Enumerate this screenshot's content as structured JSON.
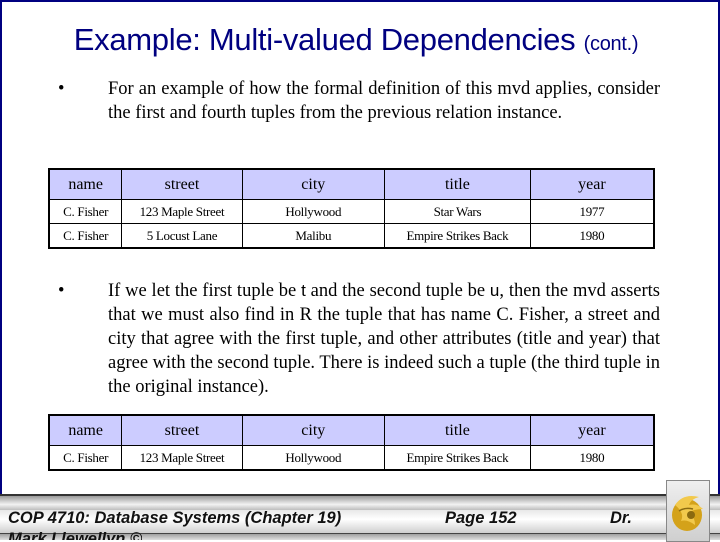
{
  "slide": {
    "title_main": "Example: Multi-valued Dependencies",
    "title_suffix": "(cont.)",
    "bullet_glyph": "•",
    "bullet1": "For an example of how the formal definition of this mvd applies, consider the first and fourth tuples from the previous relation instance.",
    "bullet2": {
      "part1": "If we let the first tuple be ",
      "var_t": "t",
      "part2": " and the second tuple be ",
      "var_u": "u",
      "part3": ", then the mvd asserts that we must also find in R the tuple that has name C. Fisher, a street and city that agree with the first tuple, and other attributes (title and year) that agree with the second tuple.  There is indeed such a tuple (the third tuple in the original instance)."
    }
  },
  "table1": {
    "headers": [
      "name",
      "street",
      "city",
      "title",
      "year"
    ],
    "rows": [
      [
        "C. Fisher",
        "123 Maple Street",
        "Hollywood",
        "Star Wars",
        "1977"
      ],
      [
        "C. Fisher",
        "5 Locust Lane",
        "Malibu",
        "Empire Strikes Back",
        "1980"
      ]
    ]
  },
  "table2": {
    "headers": [
      "name",
      "street",
      "city",
      "title",
      "year"
    ],
    "rows": [
      [
        "C. Fisher",
        "123 Maple Street",
        "Hollywood",
        "Empire Strikes Back",
        "1980"
      ]
    ]
  },
  "footer": {
    "course": "COP 4710: Database Systems  (Chapter 19)",
    "page": "Page 152",
    "dr": "Dr.",
    "author": "Mark Llewellyn ©",
    "logo_icon": "ucf-pegasus-logo"
  },
  "colors": {
    "title": "#000080",
    "header_fill": "#ccccff",
    "frame": "#000080"
  }
}
